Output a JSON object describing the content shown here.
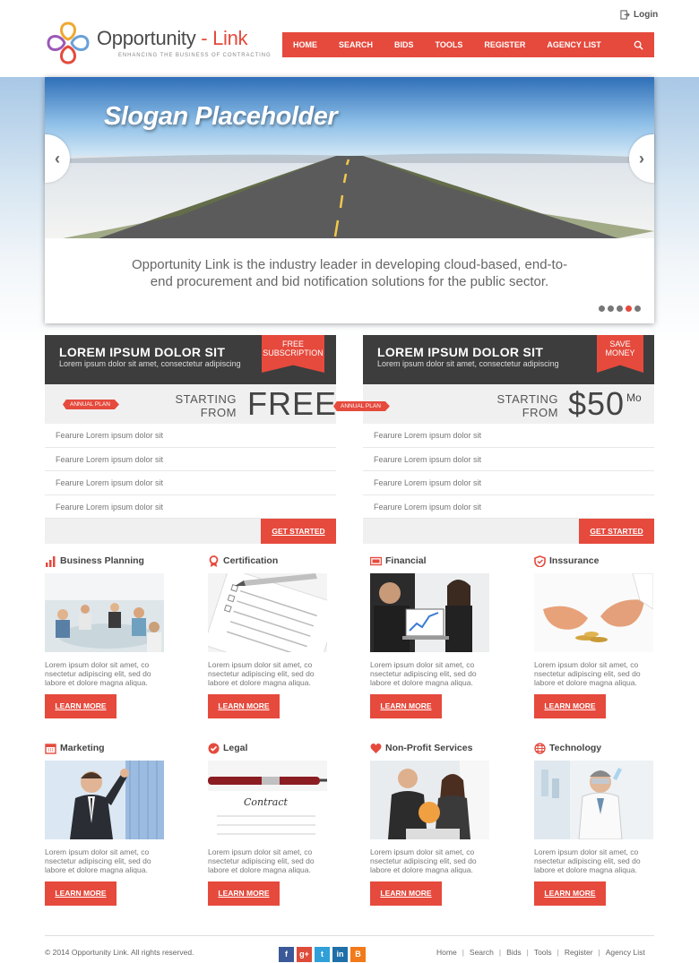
{
  "header": {
    "login_label": "Login",
    "logo": {
      "name_a": "Opportunity",
      "name_dash": " - ",
      "name_b": "Link",
      "tagline": "ENHANCING THE BUSINESS OF CONTRACTING"
    },
    "nav": [
      "HOME",
      "SEARCH",
      "BIDS",
      "TOOLS",
      "REGISTER",
      "AGENCY LIST"
    ]
  },
  "hero": {
    "slogan": "Slogan Placeholder",
    "text": "Opportunity Link is the industry leader in developing cloud-based, end-to-end procurement and bid notification solutions for the public sector.",
    "active_slide": 4,
    "slide_count": 5
  },
  "plans": [
    {
      "title": "LOREM IPSUM DOLOR SIT",
      "subtitle": "Lorem ipsum dolor sit amet, consectetur adipiscing",
      "ribbon": "FREE SUBSCRIPTION",
      "tag": "ANNUAL PLAN",
      "starting": "STARTING",
      "from": "FROM",
      "price": "FREE",
      "unit": "",
      "features": [
        "Fearure Lorem ipsum dolor sit",
        "Fearure Lorem ipsum dolor sit",
        "Fearure Lorem ipsum dolor sit",
        "Fearure Lorem ipsum dolor sit"
      ],
      "cta": "GET STARTED"
    },
    {
      "title": "LOREM IPSUM DOLOR SIT",
      "subtitle": "Lorem ipsum dolor sit amet, consectetur adipiscing",
      "ribbon": "SAVE MONEY",
      "tag": "ANNUAL PLAN",
      "starting": "STARTING",
      "from": "FROM",
      "price": "$50",
      "unit": "Mo",
      "features": [
        "Fearure Lorem ipsum dolor sit",
        "Fearure Lorem ipsum dolor sit",
        "Fearure Lorem ipsum dolor sit",
        "Fearure Lorem ipsum dolor sit"
      ],
      "cta": "GET STARTED"
    }
  ],
  "services": [
    {
      "title": "Business Planning",
      "icon": "bar-chart-icon",
      "text": "Lorem ipsum dolor sit amet, co nsectetur adipiscing elit, sed do labore et dolore magna aliqua.",
      "cta": "LEARN MORE"
    },
    {
      "title": "Certification",
      "icon": "award-ribbon-icon",
      "text": "Lorem ipsum dolor sit amet, co nsectetur adipiscing elit, sed do labore et dolore magna aliqua.",
      "cta": "LEARN MORE"
    },
    {
      "title": "Financial",
      "icon": "money-bill-icon",
      "text": "Lorem ipsum dolor sit amet, co nsectetur adipiscing elit, sed do labore et dolore magna aliqua.",
      "cta": "LEARN MORE"
    },
    {
      "title": "Inssurance",
      "icon": "shield-icon",
      "text": "Lorem ipsum dolor sit amet, co nsectetur adipiscing elit, sed do labore et dolore magna aliqua.",
      "cta": "LEARN MORE"
    },
    {
      "title": "Marketing",
      "icon": "calendar-icon",
      "text": "Lorem ipsum dolor sit amet, co nsectetur adipiscing elit, sed do labore et dolore magna aliqua.",
      "cta": "LEARN MORE"
    },
    {
      "title": "Legal",
      "icon": "check-circle-icon",
      "text": "Lorem ipsum dolor sit amet, co nsectetur adipiscing elit, sed do labore et dolore magna aliqua.",
      "cta": "LEARN MORE"
    },
    {
      "title": "Non-Profit Services",
      "icon": "heart-icon",
      "text": "Lorem ipsum dolor sit amet, co nsectetur adipiscing elit, sed do labore et dolore magna aliqua.",
      "cta": "LEARN MORE"
    },
    {
      "title": "Technology",
      "icon": "globe-icon",
      "text": "Lorem ipsum dolor sit amet, co nsectetur adipiscing elit, sed do labore et dolore magna aliqua.",
      "cta": "LEARN MORE"
    }
  ],
  "footer": {
    "copyright": "© 2014 Opportunity Link. All rights reserved.",
    "social": [
      {
        "name": "facebook",
        "glyph": "f",
        "color": "#3b5998"
      },
      {
        "name": "google-plus",
        "glyph": "g+",
        "color": "#dd4b39"
      },
      {
        "name": "twitter",
        "glyph": "t",
        "color": "#2fa0d8"
      },
      {
        "name": "linkedin",
        "glyph": "in",
        "color": "#1f6fa8"
      },
      {
        "name": "blogger",
        "glyph": "B",
        "color": "#f27a1a"
      }
    ],
    "links": [
      "Home",
      "Search",
      "Bids",
      "Tools",
      "Register",
      "Agency List"
    ]
  },
  "colors": {
    "accent": "#e54a3d",
    "dark": "#3d3d3d",
    "light_panel": "#f0f0f0"
  }
}
